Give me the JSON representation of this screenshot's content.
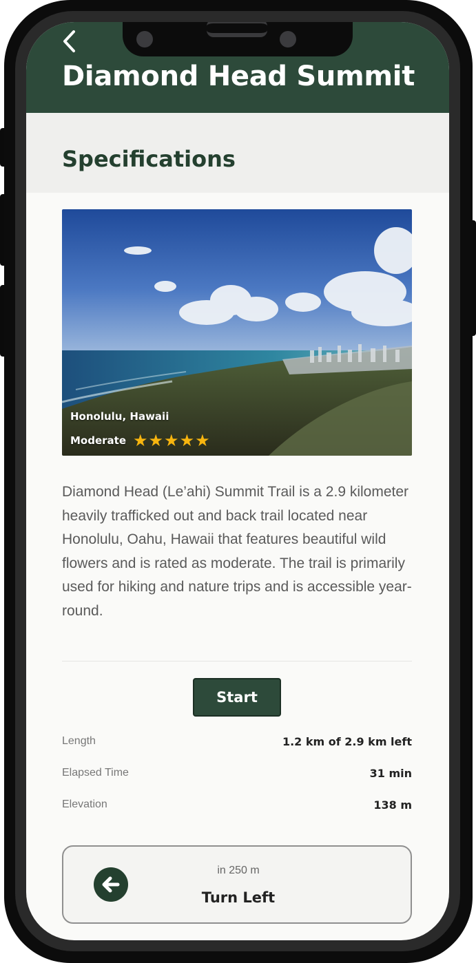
{
  "header": {
    "title": "Diamond Head Summit",
    "back_icon": "chevron-left-icon"
  },
  "section": {
    "title": "Specifications"
  },
  "hero": {
    "location": "Honolulu, Hawaii",
    "difficulty": "Moderate",
    "rating": 5,
    "star_color": "#f7b50f"
  },
  "description": "Diamond Head (Le’ahi) Summit Trail is a 2.9 kilometer heavily trafficked out and back trail located near Honolulu, Oahu, Hawaii that features beautiful wild flowers and is rated as moderate. The trail is primarily used for hiking and nature trips and is accessible year-round.",
  "actions": {
    "start_label": "Start"
  },
  "stats": [
    {
      "label": "Length",
      "value": "1.2 km of 2.9 km left"
    },
    {
      "label": "Elapsed Time",
      "value": "31 min"
    },
    {
      "label": "Elevation",
      "value": "138 m"
    }
  ],
  "navigation": {
    "distance": "in 250 m",
    "instruction": "Turn Left",
    "icon": "arrow-left-circle-icon"
  },
  "colors": {
    "brand_dark_green": "#2d4a3a",
    "section_band": "#efefed",
    "background": "#fafaf8"
  }
}
